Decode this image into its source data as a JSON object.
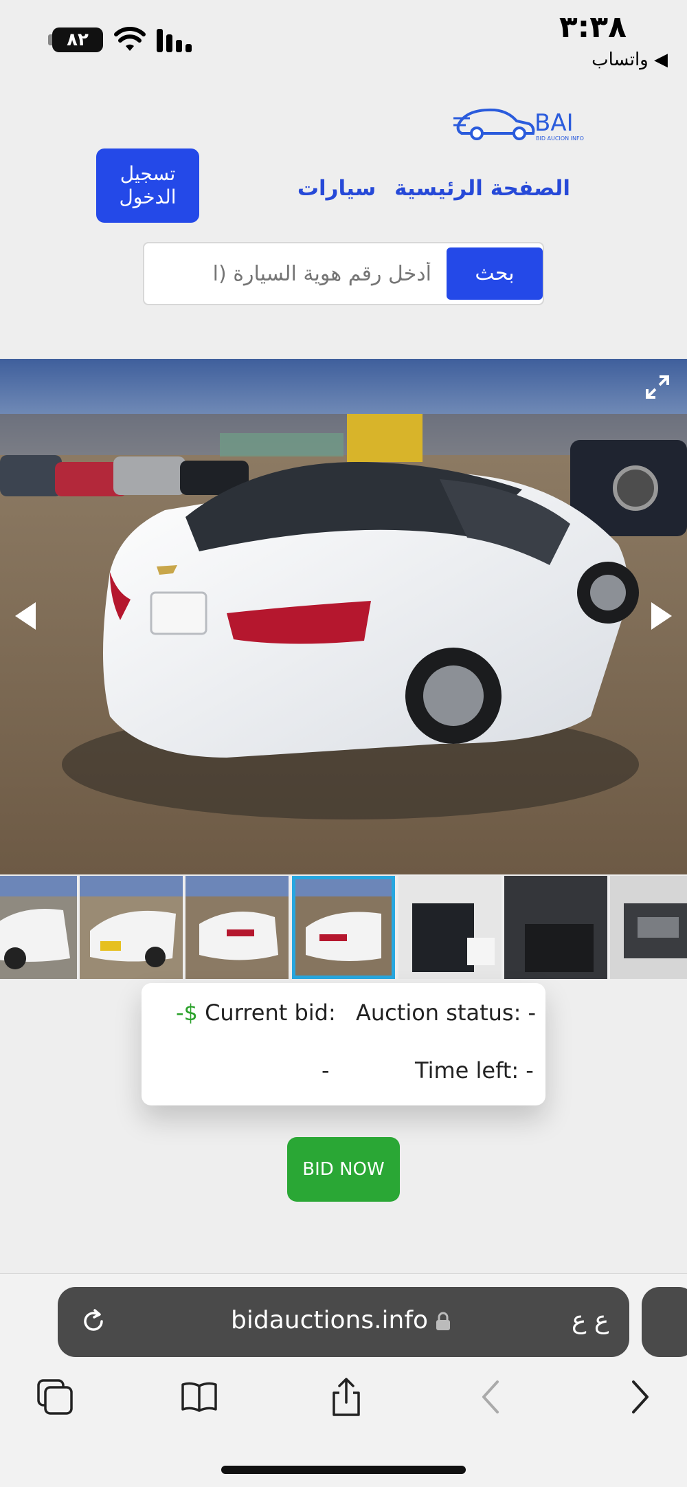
{
  "status_bar": {
    "time": "٣:٣٨",
    "back_app": "◀ واتساب",
    "battery": "٨٢"
  },
  "header": {
    "logo_text": "BAI",
    "logo_subtext": "BID AUCION INFO",
    "login_button": "تسجيل الدخول",
    "nav_home": "الصفحة الرئيسية",
    "nav_cars": "سيارات"
  },
  "search": {
    "button_label": "بحث",
    "placeholder": "أدخل رقم هوية السيارة (ا"
  },
  "gallery": {
    "thumbnail_count": 7,
    "active_thumbnail": 4
  },
  "auction": {
    "status_label": "Auction status: -",
    "current_bid_label": "Current bid:",
    "current_bid_value": "-$",
    "time_left_label": "Time left: -",
    "extra_value": "-"
  },
  "bid_button": "BID NOW",
  "browser": {
    "url": "bidauctions.info",
    "reader_label": "ع ع"
  },
  "colors": {
    "accent_blue": "#2449e8",
    "nav_blue": "#2649d8",
    "bid_green": "#2aa735",
    "thumb_active": "#27a7e0"
  }
}
